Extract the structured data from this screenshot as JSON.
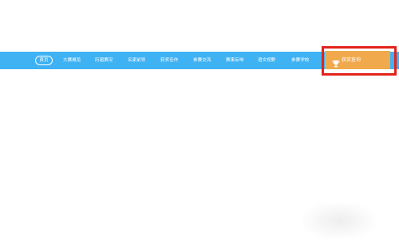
{
  "nav": {
    "home": "首页",
    "items": [
      "大赛概览",
      "历届赛况",
      "名家前导",
      "获奖佳作",
      "参赛交流",
      "赛事反响",
      "语文视野",
      "参赛学校"
    ],
    "award_query": "获奖查询"
  },
  "colors": {
    "nav_background": "#3fb2f3",
    "award_tab_background": "#f0a94c",
    "highlight_border": "#e2231a",
    "nav_text": "#ffffff"
  },
  "icons": {
    "award_tab": "trophy-icon"
  }
}
